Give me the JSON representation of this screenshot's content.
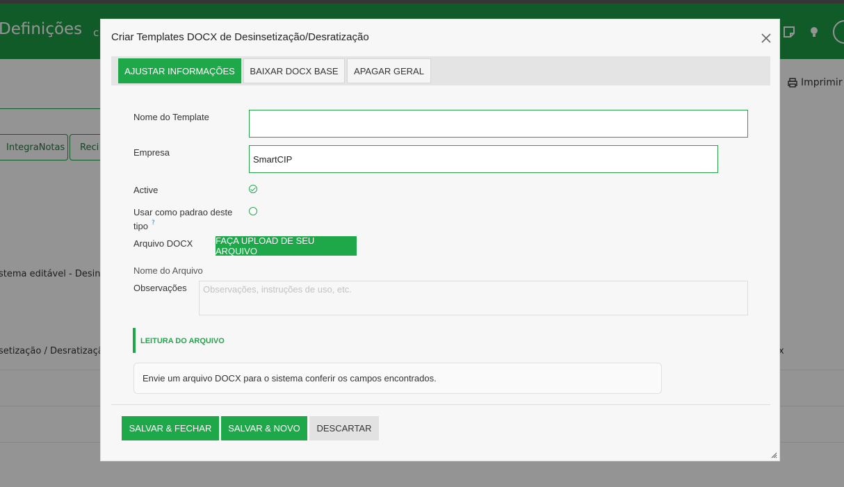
{
  "background": {
    "app_title": "Definições",
    "app_subtitle": "c",
    "print_label": "Imprimir",
    "tabs": [
      "IntegraNotas",
      "Reci"
    ],
    "row1_text": "stema editável - Desinse",
    "row2_text": "setização / Desratizaçã",
    "row2_right": "x"
  },
  "modal": {
    "title": "Criar Templates DOCX de Desinsetização/Desratização",
    "tabs": [
      {
        "label": "AJUSTAR INFORMAÇÕES",
        "active": true
      },
      {
        "label": "BAIXAR DOCX BASE",
        "active": false
      },
      {
        "label": "APAGAR GERAL",
        "active": false
      }
    ],
    "form": {
      "template_name_label": "Nome do Template",
      "template_name_value": "",
      "company_label": "Empresa",
      "company_value": "SmartCIP",
      "active_label": "Active",
      "active_checked": true,
      "default_label_line1": "Usar como padrao deste",
      "default_label_line2": "tipo",
      "default_help": "?",
      "default_checked": false,
      "docx_label": "Arquivo DOCX",
      "upload_button": "FAÇA UPLOAD DE SEU ARQUIVO",
      "file_name_label": "Nome do Arquivo",
      "notes_label": "Observações",
      "notes_placeholder": "Observações, instruções de uso, etc."
    },
    "reading": {
      "title": "LEITURA DO ARQUIVO",
      "message": "Envie um arquivo DOCX para o sistema conferir os campos encontrados."
    },
    "footer": {
      "save_close": "SALVAR & FECHAR",
      "save_new": "SALVAR & NOVO",
      "discard": "DESCARTAR"
    }
  },
  "colors": {
    "primary": "#1ea84a",
    "appbar": "#1e9e45",
    "overlay": "rgba(0,0,0,0.42)"
  }
}
